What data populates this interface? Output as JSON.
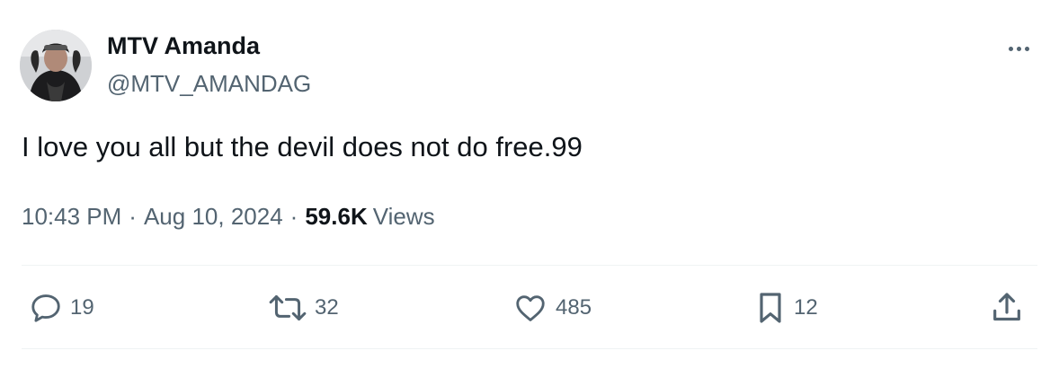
{
  "author": {
    "display_name": "MTV Amanda",
    "handle": "@MTV_AMANDAG"
  },
  "tweet": {
    "text": "I love you all but the devil does not do free.99"
  },
  "meta": {
    "time": "10:43 PM",
    "separator": "·",
    "date": "Aug 10, 2024",
    "views_count": "59.6K",
    "views_label": "Views"
  },
  "actions": {
    "replies": "19",
    "retweets": "32",
    "likes": "485",
    "bookmarks": "12"
  },
  "icons": {
    "more": "more-horizontal-icon",
    "reply": "reply-icon",
    "retweet": "retweet-icon",
    "like": "heart-icon",
    "bookmark": "bookmark-icon",
    "share": "share-icon"
  }
}
